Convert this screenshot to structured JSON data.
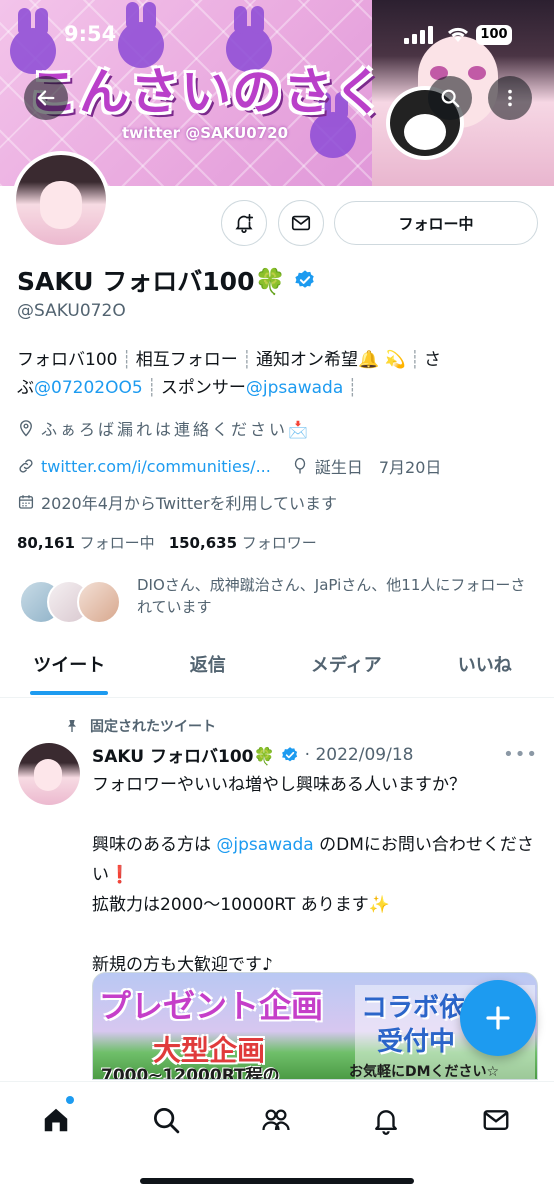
{
  "status_bar": {
    "time": "9:54",
    "battery": "100"
  },
  "banner": {
    "title": "こんさいのさく",
    "subtitle": "twitter @SAKU0720"
  },
  "header": {
    "back_icon": "arrow-left-icon",
    "search_icon": "search-icon",
    "more_icon": "more-icon"
  },
  "profile": {
    "follow_button_label": "フォロー中",
    "name": "SAKU フォロバ100🍀",
    "handle": "@SAKU072O",
    "bio": {
      "line1_a": "フォロバ100",
      "line1_b": "相互フォロー",
      "line1_c": "通知オン希望🔔 💫",
      "line1_d": "さ",
      "line2_a": "ぶ",
      "line2_link": "@07202OO5",
      "line2_b": "スポンサー",
      "line2_link2": "@jpsawada"
    },
    "location": "ふぁろば漏れは連絡ください📩",
    "website": "twitter.com/i/communities/...",
    "birthday": "誕生日　7月20日",
    "joined": "2020年4月からTwitterを利用しています",
    "following_count": "80,161",
    "following_label": "フォロー中",
    "followers_count": "150,635",
    "followers_label": "フォロワー",
    "followed_by": "DIOさん、成神蹴治さん、JaPiさん、他11人にフォローされています"
  },
  "tabs": [
    {
      "label": "ツイート",
      "active": true
    },
    {
      "label": "返信",
      "active": false
    },
    {
      "label": "メディア",
      "active": false
    },
    {
      "label": "いいね",
      "active": false
    }
  ],
  "pinned_tweet": {
    "pinned_label": "固定されたツイート",
    "author": "SAKU フォロバ100🍀",
    "date": "· 2022/09/18",
    "more": "•••",
    "line1": "フォロワーやいいね増やし興味ある人いますか？",
    "line2_a": "興味のある方は ",
    "line2_link": "@jpsawada",
    "line2_b": " のDMにお問い合わせください❗",
    "line3": "拡散力は2000～10000RT あります✨",
    "line4": "新規の方も大歓迎です♪",
    "media": {
      "left_title": "プレゼント企画",
      "big_text": "大型企画",
      "small_text": "7000~12000RT程の",
      "right_line1": "コラボ依",
      "right_line2": "受付中",
      "right_line3": "お気軽にDMください☆"
    }
  },
  "bottom_nav": [
    "home-icon",
    "search-icon",
    "communities-icon",
    "notifications-icon",
    "messages-icon"
  ],
  "colors": {
    "accent": "#1d9bf0",
    "text": "#0f1419",
    "secondary": "#536471"
  }
}
